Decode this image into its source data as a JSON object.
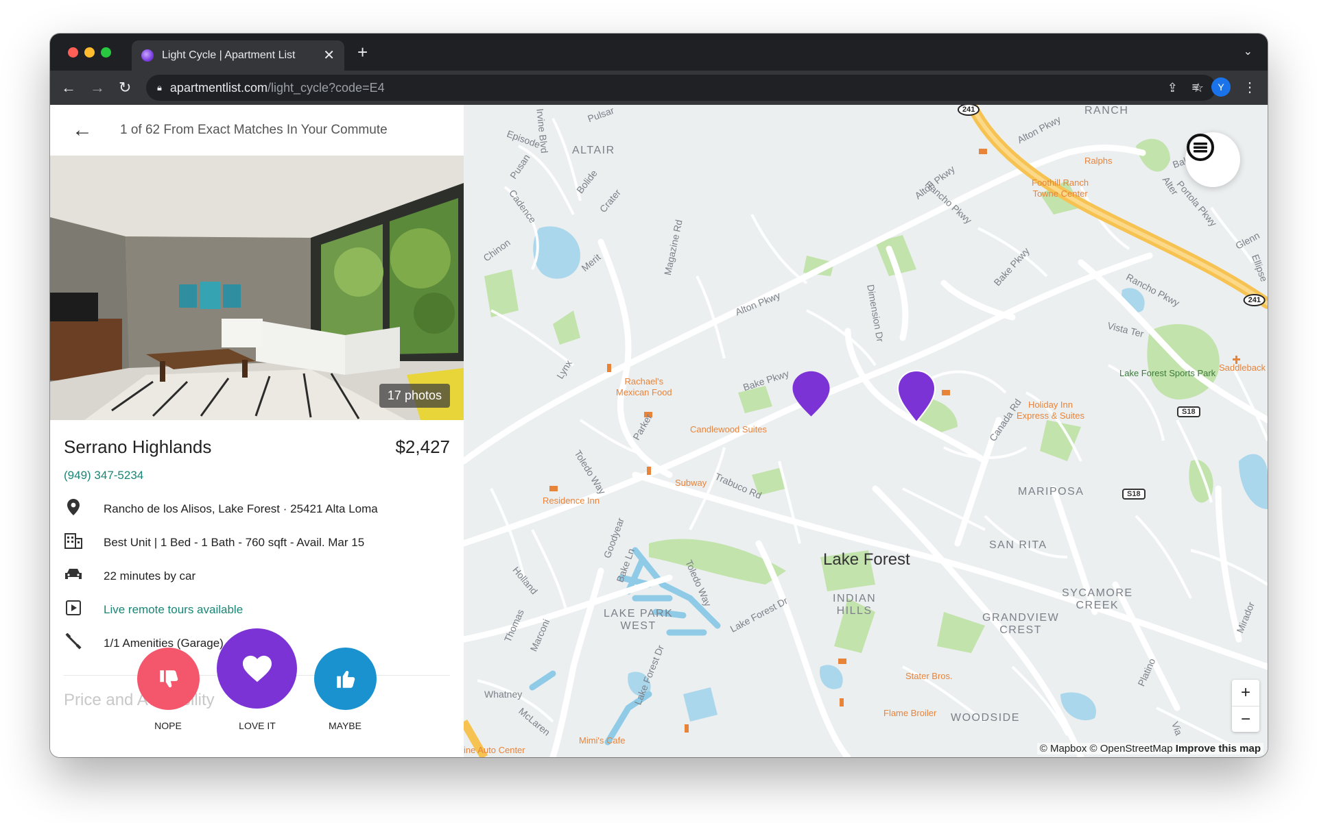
{
  "browser": {
    "tab_title": "Light Cycle | Apartment List",
    "tab_close": "✕",
    "new_tab": "+",
    "url_host": "apartmentlist.com",
    "url_path": "/light_cycle?code=E4",
    "profile_initial": "Y"
  },
  "panel": {
    "subtitle": "1 of 62 From Exact Matches In Your Commute",
    "photo_count": "17 photos",
    "name": "Serrano Highlands",
    "price": "$2,427",
    "phone": "(949) 347-5234",
    "details": [
      {
        "icon": "location-pin-icon",
        "text": "Rancho de los Alisos, Lake Forest · 25421 Alta Loma",
        "link": false
      },
      {
        "icon": "building-icon",
        "text": "Best Unit | 1 Bed  - 1 Bath  - 760 sqft  - Avail. Mar 15",
        "link": false
      },
      {
        "icon": "car-icon",
        "text": "22 minutes by car",
        "link": false
      },
      {
        "icon": "play-icon",
        "text": "Live remote tours available",
        "link": true
      },
      {
        "icon": "amenities-icon",
        "text": "1/1 Amenities (Garage)",
        "link": false
      }
    ],
    "section_title": "Price and Availability",
    "actions": {
      "nope": "NOPE",
      "love": "LOVE IT",
      "maybe": "MAYBE"
    }
  },
  "map": {
    "city": "Lake Forest",
    "areas": [
      "RANCH",
      "ALTAIR",
      "MARIPOSA",
      "SAN RITA",
      "INDIAN\nHILLS",
      "LAKE PARK\nWEST",
      "GRANDVIEW\nCREST",
      "SYCAMORE\nCREEK",
      "WOODSIDE"
    ],
    "roads": [
      "Alton Pkwy",
      "Bake Pkwy",
      "Trabuco Rd",
      "Rancho Pkwy",
      "Vista Ter",
      "Dimension Dr",
      "Irvine Blvd",
      "Magazine Rd",
      "Lake Forest Dr",
      "Toledo Way",
      "Canada Rd",
      "Episode",
      "Pusan",
      "Bolide",
      "Crater",
      "Cadence",
      "Chinon",
      "Merit",
      "Lynx",
      "Parker",
      "Goodyear",
      "Holland",
      "Thomas",
      "Marconi",
      "Whatney",
      "McLaren",
      "Bake Ln",
      "Portola Pkwy",
      "Alter",
      "Glenn",
      "Ellipse",
      "Mirador",
      "Platino",
      "Via",
      "Pulsar"
    ],
    "pois": [
      "Rachael's\nMexican Food",
      "Candlewood Suites",
      "Subway",
      "Residence Inn",
      "Foothill Ranch\nTowne Center",
      "Ralphs",
      "Holiday Inn\nExpress & Suites",
      "Stater Bros.",
      "Flame Broiler",
      "Mimi's Cafe",
      "ine Auto Center",
      "Saddleback"
    ],
    "park": "Lake Forest Sports Park",
    "shields": [
      "241",
      "241",
      "S18",
      "S18"
    ],
    "zoom_in": "+",
    "zoom_out": "−",
    "attribution_a": "© Mapbox © OpenStreetMap ",
    "attribution_b": "Improve this map",
    "colors": {
      "pin": "#7c33d6",
      "highway": "#f7c253",
      "water": "#a9d6ea",
      "park": "#b9dea0"
    }
  }
}
